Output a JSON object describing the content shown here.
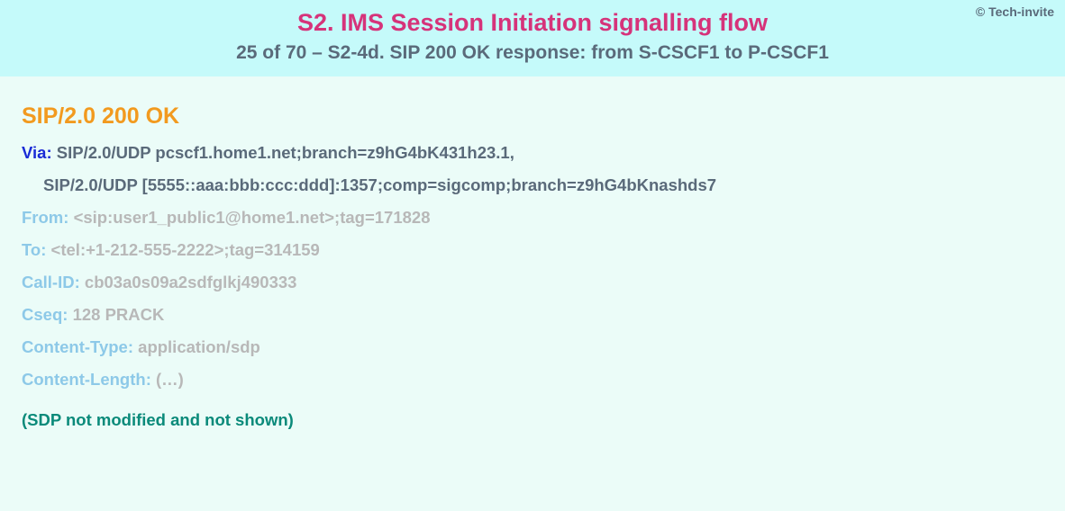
{
  "copyright": "© Tech-invite",
  "title": "S2. IMS Session Initiation signalling flow",
  "subtitle": "25 of 70 – S2-4d. SIP 200 OK response: from S-CSCF1 to P-CSCF1",
  "status_line": "SIP/2.0 200 OK",
  "headers": {
    "via": {
      "name": "Via",
      "line1": "SIP/2.0/UDP pcscf1.home1.net;branch=z9hG4bK431h23.1,",
      "line2": "SIP/2.0/UDP [5555::aaa:bbb:ccc:ddd]:1357;comp=sigcomp;branch=z9hG4bKnashds7"
    },
    "from": {
      "name": "From",
      "value": "<sip:user1_public1@home1.net>;tag=171828"
    },
    "to": {
      "name": "To",
      "value": "<tel:+1-212-555-2222>;tag=314159"
    },
    "call_id": {
      "name": "Call-ID",
      "value": "cb03a0s09a2sdfglkj490333"
    },
    "cseq": {
      "name": "Cseq",
      "value": "128 PRACK"
    },
    "content_type": {
      "name": "Content-Type",
      "value": "application/sdp"
    },
    "content_length": {
      "name": "Content-Length",
      "value": "(…)"
    }
  },
  "sdp_note": "(SDP not modified and not shown)"
}
